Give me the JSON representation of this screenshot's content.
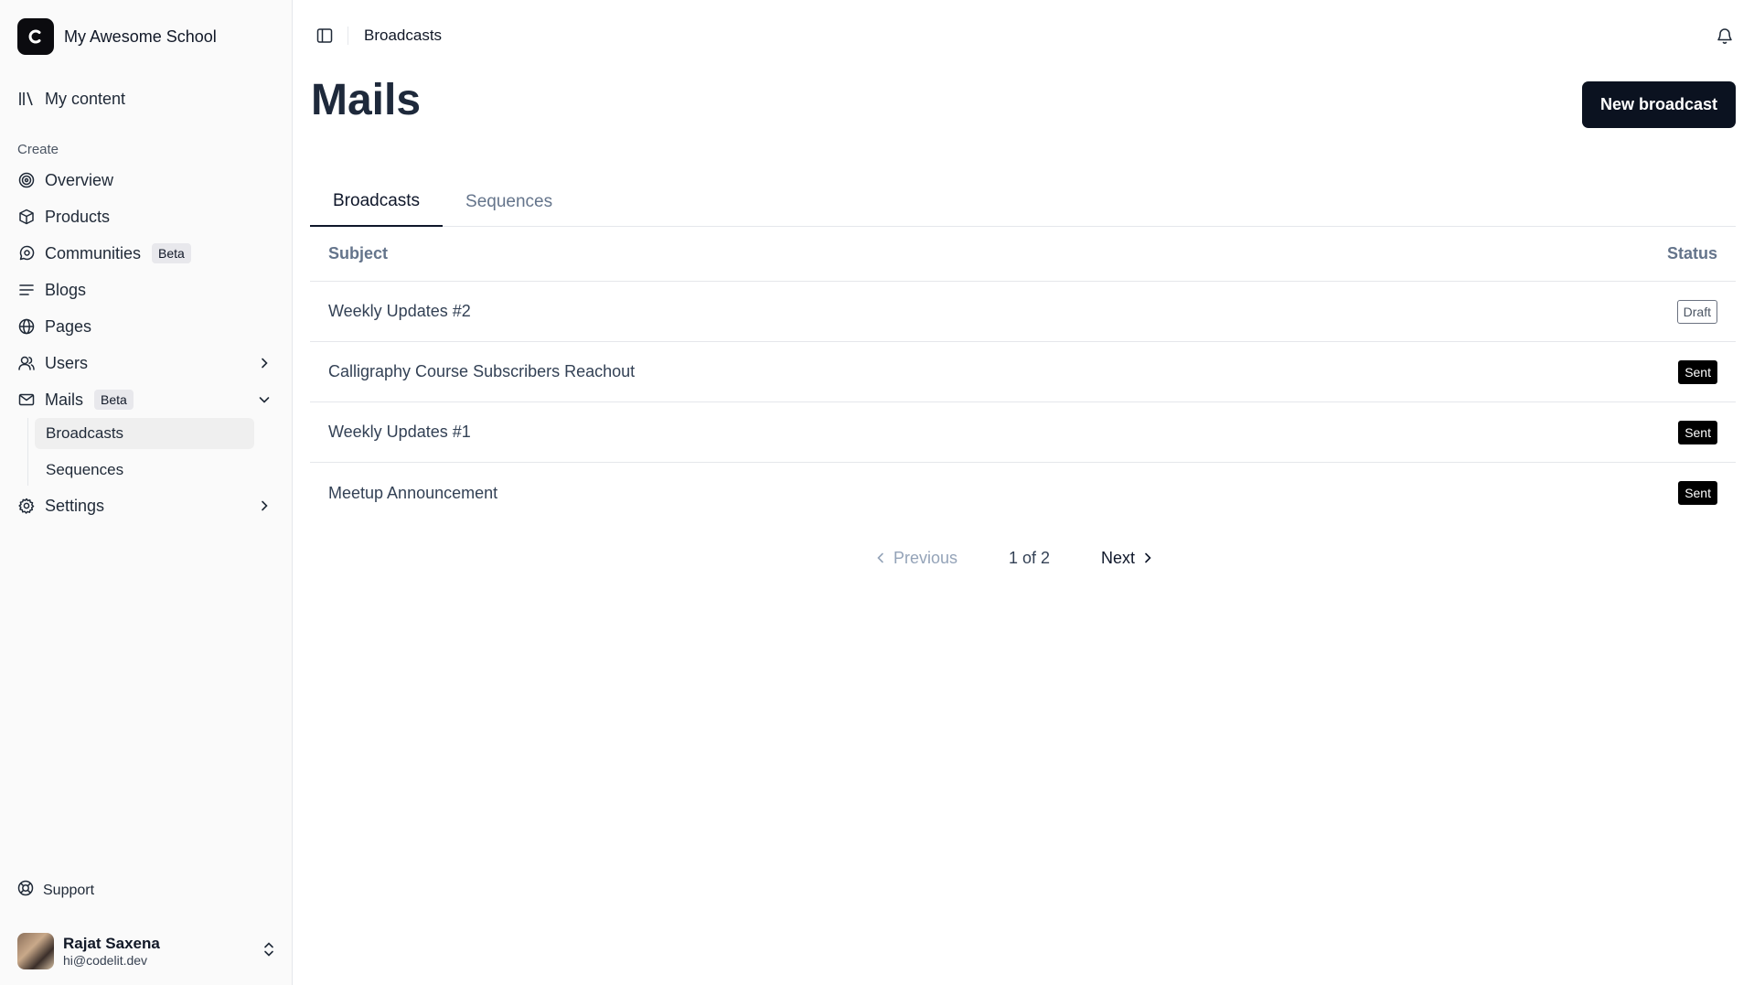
{
  "brand": {
    "name": "My Awesome School",
    "logo_letter": "C"
  },
  "sidebar": {
    "my_content": "My content",
    "create_section": "Create",
    "items": [
      {
        "label": "Overview",
        "icon": "target-icon"
      },
      {
        "label": "Products",
        "icon": "box-icon"
      },
      {
        "label": "Communities",
        "icon": "chat-icon",
        "badge": "Beta"
      },
      {
        "label": "Blogs",
        "icon": "lines-icon"
      },
      {
        "label": "Pages",
        "icon": "globe-icon"
      },
      {
        "label": "Users",
        "icon": "users-icon"
      },
      {
        "label": "Mails",
        "icon": "mail-icon",
        "badge": "Beta"
      },
      {
        "label": "Settings",
        "icon": "gear-icon"
      }
    ],
    "mails_sub": [
      "Broadcasts",
      "Sequences"
    ],
    "support": "Support",
    "user": {
      "name": "Rajat Saxena",
      "email": "hi@codelit.dev"
    }
  },
  "header": {
    "breadcrumb": "Broadcasts"
  },
  "main": {
    "title": "Mails",
    "new_button": "New broadcast",
    "tabs": [
      {
        "label": "Broadcasts"
      },
      {
        "label": "Sequences"
      }
    ],
    "table": {
      "columns": [
        "Subject",
        "Status"
      ],
      "rows": [
        {
          "subject": "Weekly Updates #2",
          "status": "Draft"
        },
        {
          "subject": "Calligraphy Course Subscribers Reachout",
          "status": "Sent"
        },
        {
          "subject": "Weekly Updates #1",
          "status": "Sent"
        },
        {
          "subject": "Meetup Announcement",
          "status": "Sent"
        }
      ]
    },
    "pagination": {
      "previous": "Previous",
      "info": "1 of 2",
      "next": "Next"
    }
  }
}
